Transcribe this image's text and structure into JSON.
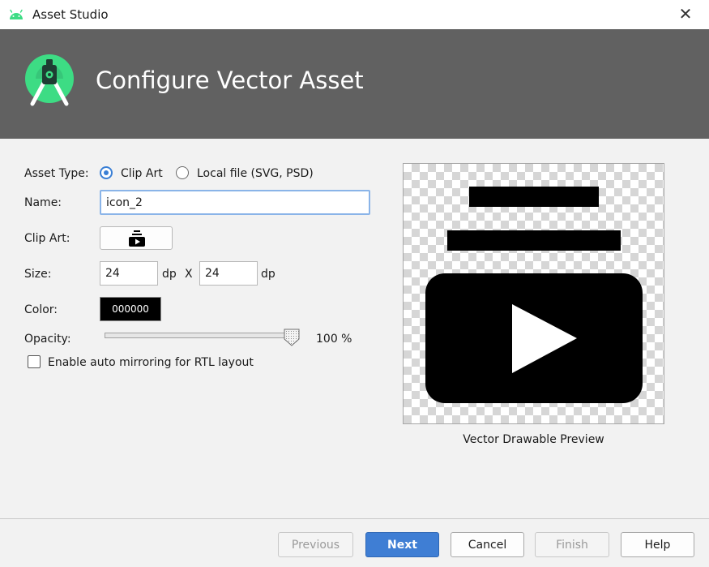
{
  "window": {
    "title": "Asset Studio",
    "app_icon": "android-robot-icon",
    "close_icon": "close-icon",
    "close_glyph": "✕"
  },
  "header": {
    "title": "Configure Vector Asset",
    "logo_icon": "android-studio-logo-icon",
    "background_color": "#616161"
  },
  "form": {
    "asset_type": {
      "label": "Asset Type:",
      "options": [
        {
          "label": "Clip Art",
          "selected": true
        },
        {
          "label": "Local file (SVG, PSD)",
          "selected": false
        }
      ]
    },
    "name": {
      "label": "Name:",
      "value": "icon_2"
    },
    "clip_art": {
      "label": "Clip Art:",
      "icon": "subscriptions-icon"
    },
    "size": {
      "label": "Size:",
      "width": "24",
      "height": "24",
      "unit": "dp",
      "separator": "X"
    },
    "color": {
      "label": "Color:",
      "value": "000000",
      "swatch_color": "#000000"
    },
    "opacity": {
      "label": "Opacity:",
      "value": 100,
      "display": "100 %"
    },
    "auto_mirroring": {
      "label": "Enable auto mirroring for RTL layout",
      "checked": false
    }
  },
  "preview": {
    "caption": "Vector Drawable Preview",
    "icon": "subscriptions-icon"
  },
  "buttons": {
    "previous": "Previous",
    "next": "Next",
    "cancel": "Cancel",
    "finish": "Finish",
    "help": "Help"
  },
  "colors": {
    "accent": "#3f7ed4",
    "radio_selected": "#3a7fd5",
    "android_green": "#3ddc84"
  }
}
